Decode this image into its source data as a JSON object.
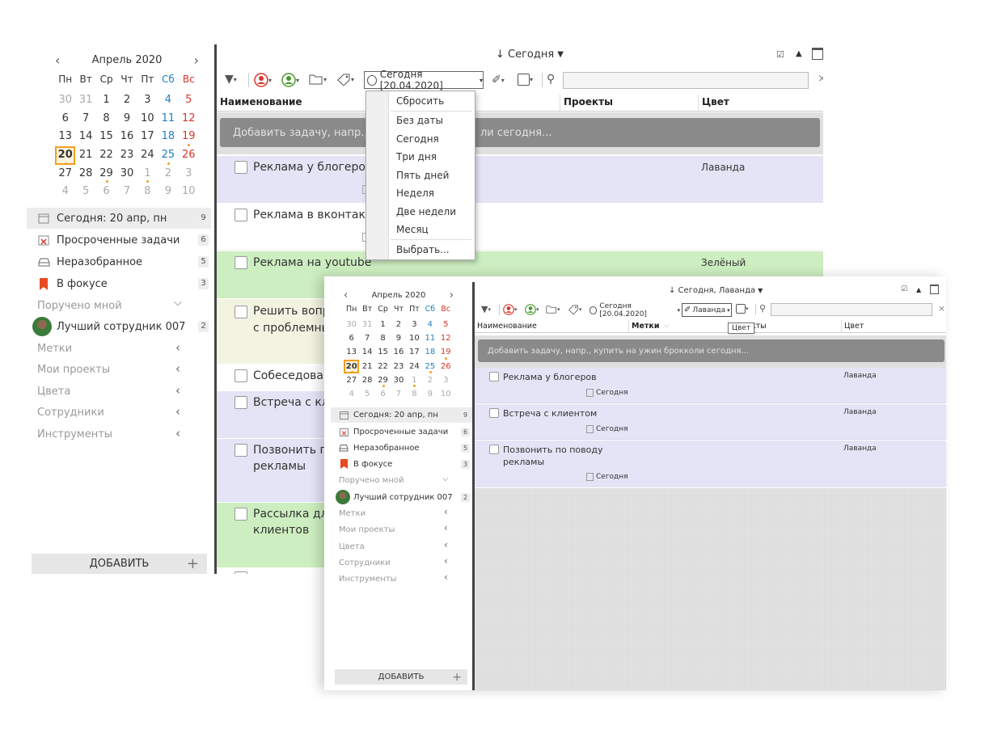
{
  "back": {
    "calendar": {
      "month": "Апрель 2020",
      "weekdays": [
        "Пн",
        "Вт",
        "Ср",
        "Чт",
        "Пт",
        "Сб",
        "Вс"
      ],
      "weeks": [
        [
          "30",
          "31",
          "1",
          "2",
          "3",
          "4",
          "5"
        ],
        [
          "6",
          "7",
          "8",
          "9",
          "10",
          "11",
          "12"
        ],
        [
          "13",
          "14",
          "15",
          "16",
          "17",
          "18",
          "19"
        ],
        [
          "20",
          "21",
          "22",
          "23",
          "24",
          "25",
          "26"
        ],
        [
          "27",
          "28",
          "29",
          "30",
          "1",
          "2",
          "3"
        ],
        [
          "4",
          "5",
          "6",
          "7",
          "8",
          "9",
          "10"
        ]
      ]
    },
    "sidebar": {
      "today": "Сегодня: 20 апр, пн",
      "today_count": "9",
      "overdue": "Просроченные задачи",
      "overdue_count": "6",
      "inbox": "Неразобранное",
      "inbox_count": "5",
      "focus": "В фокусе",
      "focus_count": "3",
      "assigned": "Поручено мной",
      "employee": "Лучший сотрудник 007",
      "employee_count": "2",
      "tags": "Метки",
      "projects": "Мои проекты",
      "colors": "Цвета",
      "staff": "Сотрудники",
      "tools": "Инструменты",
      "add": "ДОБАВИТЬ"
    },
    "main": {
      "view_title": "↓ Сегодня",
      "date_filter": "Сегодня [20.04.2020]",
      "col_name": "Наименование",
      "col_projects": "Проекты",
      "col_color": "Цвет",
      "add_placeholder_left": "Добавить задачу, напр., ку",
      "add_placeholder_right": "ли сегодня...",
      "tasks": [
        {
          "title": "Реклама у блогеров",
          "color": "Лаванда"
        },
        {
          "title": "Реклама в вконтакт",
          "color": ""
        },
        {
          "title": "Реклама на youtube",
          "color": "Зелёный"
        },
        {
          "title": "Решить вопр",
          "title2": "с проблемны"
        },
        {
          "title": "Собеседован"
        },
        {
          "title": "Встреча с кл"
        },
        {
          "title": "Позвонить п",
          "title2": "рекламы"
        },
        {
          "title": "Рассылка дл",
          "title2": "клиентов"
        }
      ],
      "dropdown": [
        "Сбросить",
        "Без даты",
        "Сегодня",
        "Три дня",
        "Пять дней",
        "Неделя",
        "Две недели",
        "Месяц",
        "Выбрать..."
      ]
    }
  },
  "front": {
    "calendar": {
      "month": "Апрель 2020",
      "weekdays": [
        "Пн",
        "Вт",
        "Ср",
        "Чт",
        "Пт",
        "Сб",
        "Вс"
      ],
      "weeks": [
        [
          "30",
          "31",
          "1",
          "2",
          "3",
          "4",
          "5"
        ],
        [
          "6",
          "7",
          "8",
          "9",
          "10",
          "11",
          "12"
        ],
        [
          "13",
          "14",
          "15",
          "16",
          "17",
          "18",
          "19"
        ],
        [
          "20",
          "21",
          "22",
          "23",
          "24",
          "25",
          "26"
        ],
        [
          "27",
          "28",
          "29",
          "30",
          "1",
          "2",
          "3"
        ],
        [
          "4",
          "5",
          "6",
          "7",
          "8",
          "9",
          "10"
        ]
      ]
    },
    "sidebar": {
      "today": "Сегодня: 20 апр, пн",
      "today_count": "9",
      "overdue": "Просроченные задачи",
      "overdue_count": "6",
      "inbox": "Неразобранное",
      "inbox_count": "5",
      "focus": "В фокусе",
      "focus_count": "3",
      "assigned": "Поручено мной",
      "employee": "Лучший сотрудник 007",
      "employee_count": "2",
      "tags": "Метки",
      "projects": "Мои проекты",
      "colors": "Цвета",
      "staff": "Сотрудники",
      "tools": "Инструменты",
      "add": "ДОБАВИТЬ"
    },
    "main": {
      "view_title": "↓ Сегодня, Лаванда",
      "date_filter": "Сегодня [20.04.2020]",
      "color_filter": "Лаванда",
      "tooltip": "Цвет",
      "col_name": "Наименование",
      "col_tags": "Метки",
      "col_projects": "екты",
      "col_color": "Цвет",
      "add_placeholder": "Добавить задачу, напр., купить на ужин брокколи сегодня...",
      "tasks": [
        {
          "title": "Реклама у блогеров",
          "due": "Сегодня",
          "color": "Лаванда"
        },
        {
          "title": "Встреча с клиентом",
          "due": "Сегодня",
          "color": "Лаванда"
        },
        {
          "title": "Позвонить по поводу",
          "title2": "рекламы",
          "due": "Сегодня",
          "color": "Лаванда"
        }
      ]
    }
  },
  "colors": {
    "lavender": "#e4e4f6",
    "green": "#cdeec0",
    "beige": "#f3f3e2",
    "accent_orange": "#f0a020",
    "weekend_blue": "#1f7fbf",
    "sunday_red": "#d9362b"
  }
}
